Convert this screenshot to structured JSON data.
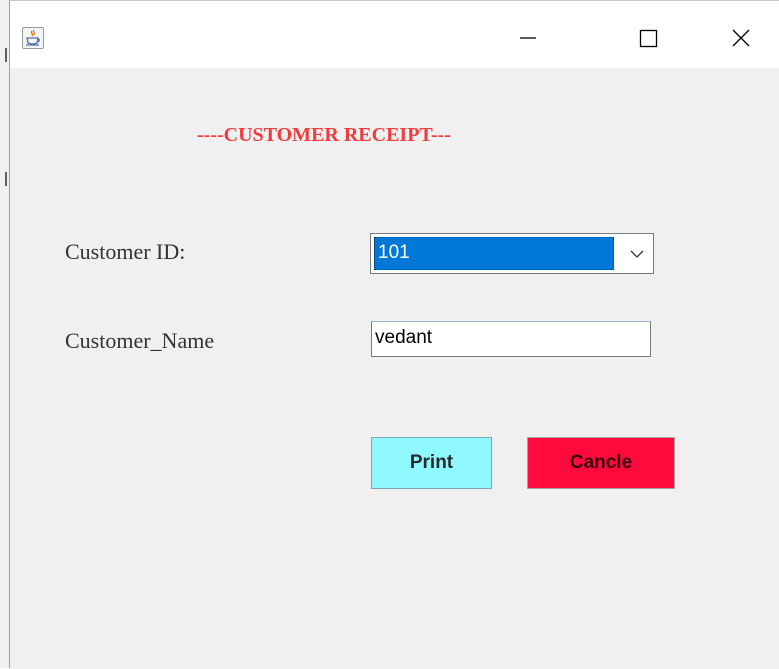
{
  "window": {
    "app_icon": "java-cup-icon",
    "controls": {
      "minimize_icon": "minimize-icon",
      "maximize_icon": "maximize-icon",
      "close_icon": "close-icon"
    }
  },
  "form": {
    "heading": "----CUSTOMER RECEIPT---",
    "customer_id_label": "Customer ID:",
    "customer_id_value": "101",
    "customer_name_label": "Customer_Name",
    "customer_name_value": "vedant"
  },
  "buttons": {
    "print_label": "Print",
    "cancel_label": "Cancle"
  },
  "colors": {
    "heading": "#f03c3c",
    "print_button": "#8ff9ff",
    "cancel_button": "#ff0a3c",
    "selection": "#0078d7",
    "panel_background": "#f0f0f0"
  }
}
